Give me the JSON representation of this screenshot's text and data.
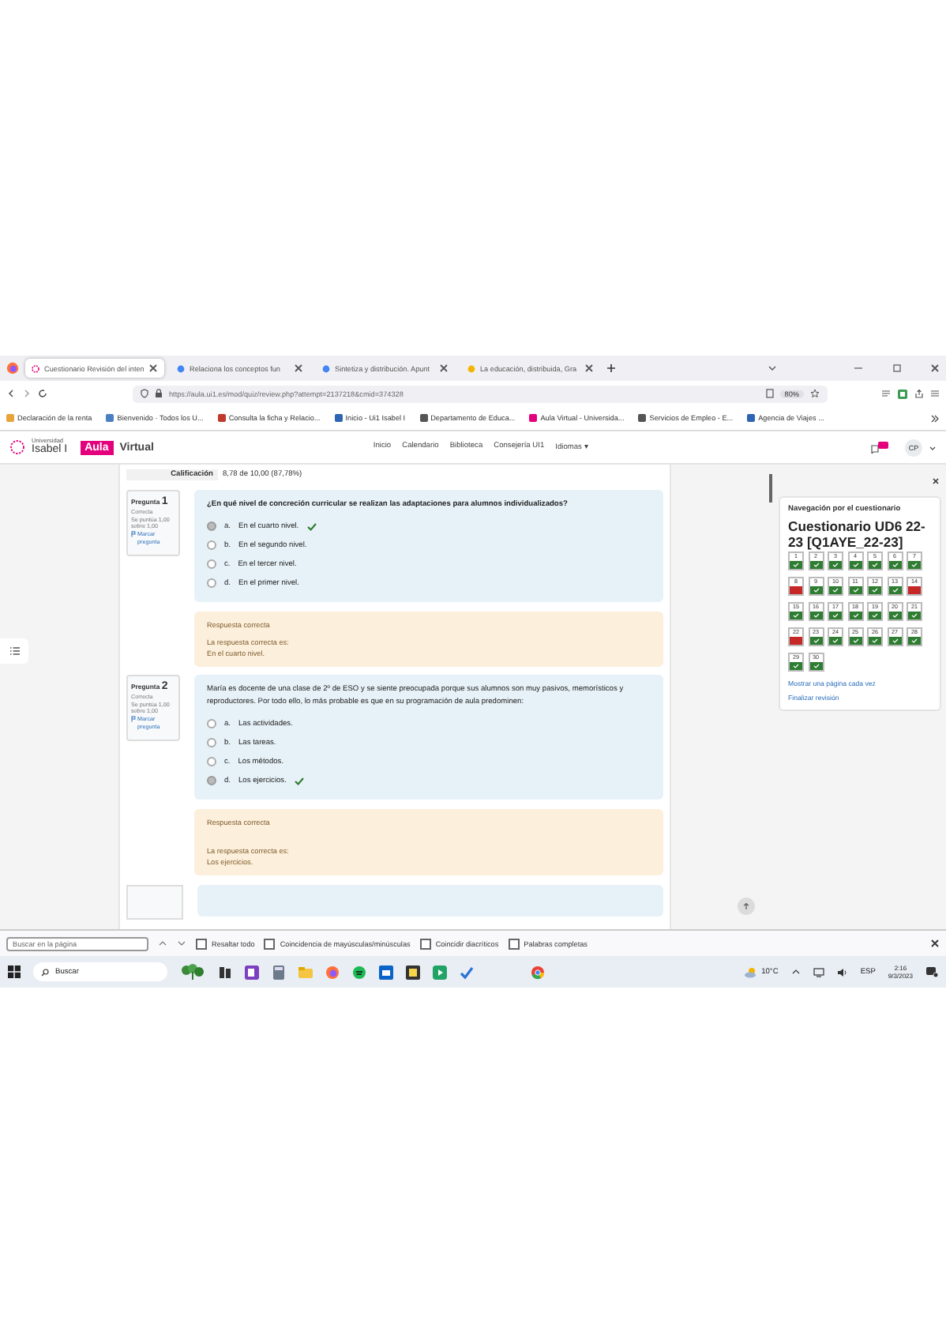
{
  "browser": {
    "tabs": [
      {
        "title": "Cuestionario Revisión del inten",
        "selected": true
      },
      {
        "title": "Relaciona los conceptos fun",
        "selected": false
      },
      {
        "title": "Sintetiza y distribución. Apunt",
        "selected": false
      },
      {
        "title": "La educación, distribuida, Gra",
        "selected": false
      }
    ],
    "url": "https://aula.ui1.es/mod/quiz/review.php?attempt=2137218&cmid=374328",
    "zoom": "80%",
    "bookmarks": [
      {
        "title": "Declaración de la renta"
      },
      {
        "title": "Bienvenido · Todos los U..."
      },
      {
        "title": "Consulta la ficha y Relacio..."
      },
      {
        "title": "Inicio - Ui1 Isabel I"
      },
      {
        "title": "Departamento de Educa..."
      },
      {
        "title": "Aula Virtual - Universida..."
      },
      {
        "title": "Servicios de Empleo - E..."
      },
      {
        "title": "Agencia de Viajes ..."
      }
    ]
  },
  "site": {
    "logo_top": "Universidad",
    "logo_bottom": "Isabel I",
    "brand_badge": "Aula",
    "brand_text": "Virtual",
    "nav": [
      {
        "label": "Inicio"
      },
      {
        "label": "Calendario"
      },
      {
        "label": "Biblioteca"
      },
      {
        "label": "Consejería UI1"
      },
      {
        "label": "Idiomas ▾"
      }
    ],
    "avatar": "CP"
  },
  "grade": {
    "label": "Calificación",
    "value": "8,78 de 10,00 (87,78%)"
  },
  "questions": [
    {
      "label": "Pregunta",
      "number": "1",
      "status": "Correcta",
      "score": "Se puntúa 1,00 sobre 1,00",
      "flag": "Marcar pregunta",
      "text": "¿En qué nivel de concreción curricular se realizan las adaptaciones para alumnos individualizados?",
      "options": [
        {
          "letter": "a.",
          "text": "En el cuarto nivel.",
          "selected": true,
          "correct": true
        },
        {
          "letter": "b.",
          "text": "En el segundo nivel.",
          "selected": false,
          "correct": false
        },
        {
          "letter": "c.",
          "text": "En el tercer nivel.",
          "selected": false,
          "correct": false
        },
        {
          "letter": "d.",
          "text": "En el primer nivel.",
          "selected": false,
          "correct": false
        }
      ],
      "feedback": {
        "title": "Respuesta correcta",
        "lines": [
          "La respuesta correcta es:",
          "En el cuarto nivel."
        ]
      }
    },
    {
      "label": "Pregunta",
      "number": "2",
      "status": "Correcta",
      "score": "Se puntúa 1,00 sobre 1,00",
      "flag": "Marcar pregunta",
      "text": "María es docente de una clase de 2º de ESO y se siente preocupada porque sus alumnos son muy pasivos, memorísticos y reproductores. Por todo ello, lo más probable es que en su programación de aula predominen:",
      "options": [
        {
          "letter": "a.",
          "text": "Las actividades.",
          "selected": false,
          "correct": false
        },
        {
          "letter": "b.",
          "text": "Las tareas.",
          "selected": false,
          "correct": false
        },
        {
          "letter": "c.",
          "text": "Los métodos.",
          "selected": false,
          "correct": false
        },
        {
          "letter": "d.",
          "text": "Los ejercicios.",
          "selected": true,
          "correct": true
        }
      ],
      "feedback": {
        "title": "Respuesta correcta",
        "lines": [
          "La respuesta correcta es:",
          "Los ejercicios."
        ]
      }
    }
  ],
  "drawer": {
    "title": "Navegación por el cuestionario",
    "quiz": "Cuestionario UD6 22-23 [Q1AYE_22-23]",
    "items": [
      {
        "label": "1",
        "correct": true
      },
      {
        "label": "2",
        "correct": true
      },
      {
        "label": "3",
        "correct": true
      },
      {
        "label": "4",
        "correct": true
      },
      {
        "label": "5",
        "correct": true
      },
      {
        "label": "6",
        "correct": true
      },
      {
        "label": "7",
        "correct": true
      },
      {
        "label": "8",
        "correct": false
      },
      {
        "label": "9",
        "correct": true
      },
      {
        "label": "10",
        "correct": true
      },
      {
        "label": "11",
        "correct": true
      },
      {
        "label": "12",
        "correct": true
      },
      {
        "label": "13",
        "correct": true
      },
      {
        "label": "14",
        "correct": false
      },
      {
        "label": "15",
        "correct": true
      },
      {
        "label": "16",
        "correct": true
      },
      {
        "label": "17",
        "correct": true
      },
      {
        "label": "18",
        "correct": true
      },
      {
        "label": "19",
        "correct": true
      },
      {
        "label": "20",
        "correct": true
      },
      {
        "label": "21",
        "correct": true
      },
      {
        "label": "22",
        "correct": false
      },
      {
        "label": "23",
        "correct": true
      },
      {
        "label": "24",
        "correct": true
      },
      {
        "label": "25",
        "correct": true
      },
      {
        "label": "26",
        "correct": true
      },
      {
        "label": "27",
        "correct": true
      },
      {
        "label": "28",
        "correct": true
      },
      {
        "label": "29",
        "correct": true
      },
      {
        "label": "30",
        "correct": true
      }
    ],
    "links": [
      {
        "label": "Mostrar una página cada vez"
      },
      {
        "label": "Finalizar revisión"
      }
    ]
  },
  "findbar": {
    "placeholder": "Buscar en la página",
    "options": [
      {
        "label": "Resaltar todo",
        "checked": false
      },
      {
        "label": "Coincidencia de mayúsculas/minúsculas",
        "checked": false
      },
      {
        "label": "Coincidir diacríticos",
        "checked": false
      },
      {
        "label": "Palabras completas",
        "checked": false
      }
    ]
  },
  "taskbar": {
    "search": "Buscar",
    "temperature": "10°C",
    "language": "ESP",
    "time": "2:16",
    "date": "9/3/2023"
  }
}
